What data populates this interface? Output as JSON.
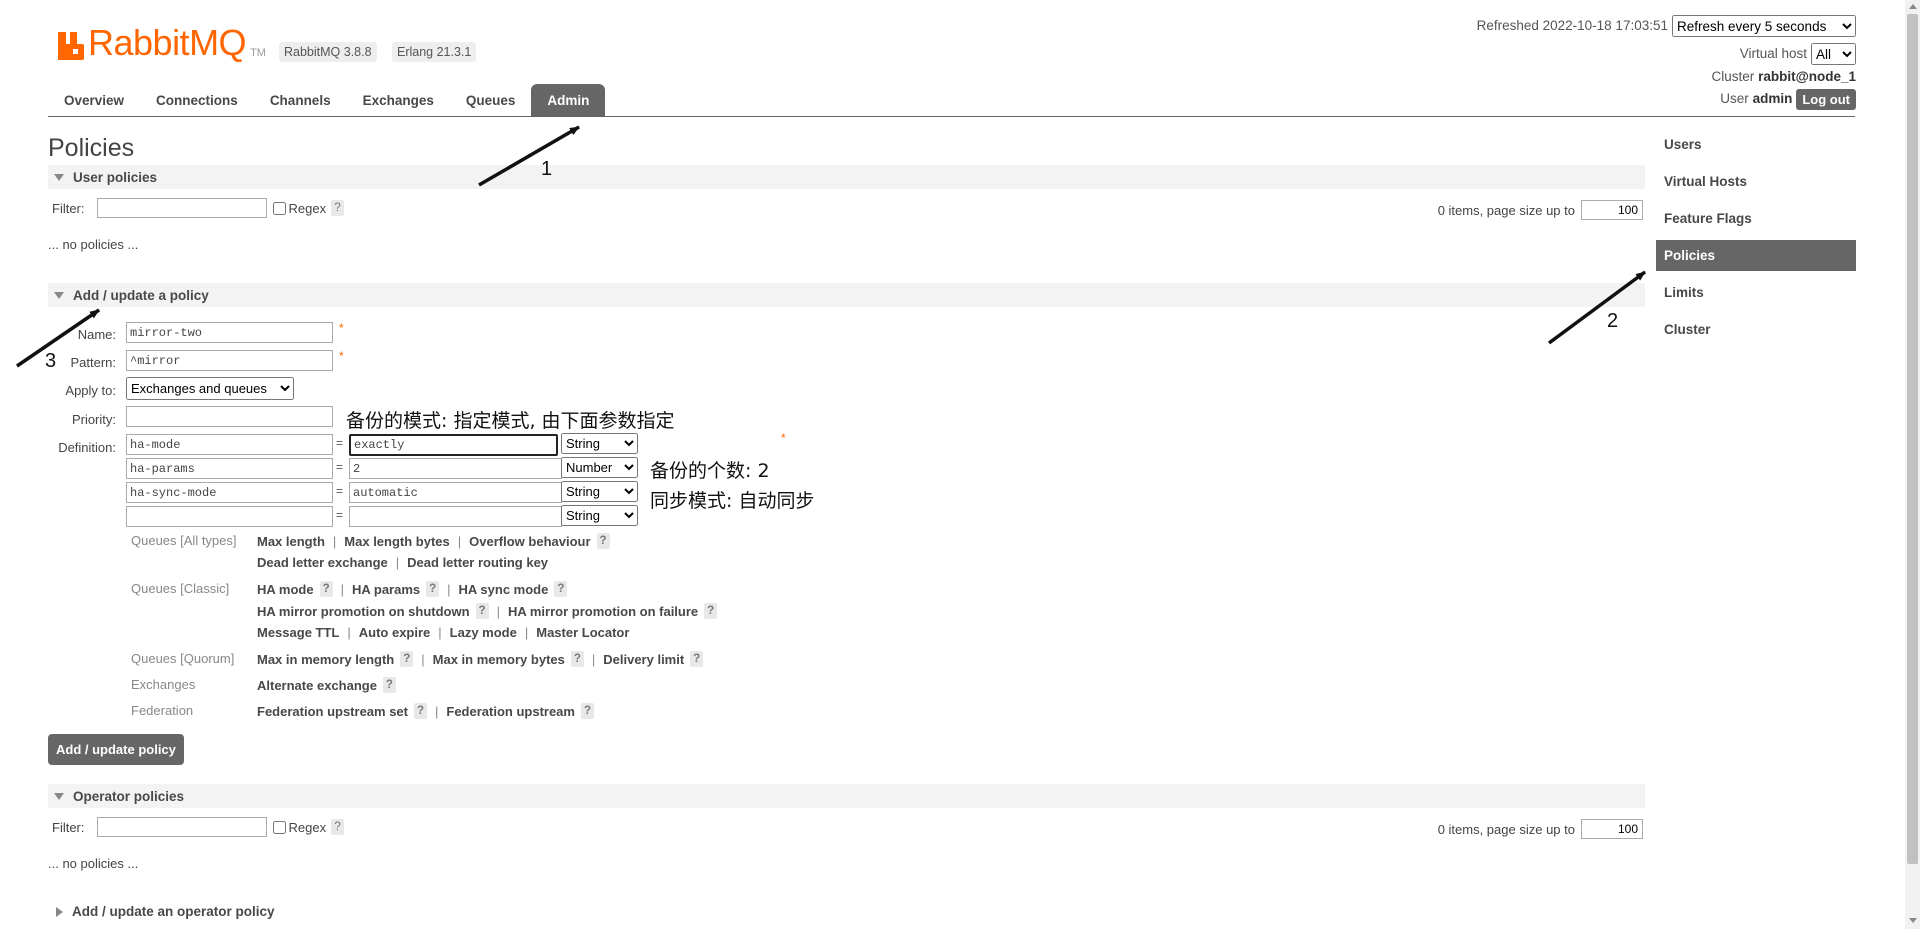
{
  "header": {
    "logo_text": "RabbitMQ",
    "logo_tm": "TM",
    "version": "RabbitMQ 3.8.8",
    "erlang": "Erlang 21.3.1",
    "refreshed_label": "Refreshed 2022-10-18 17:03:51",
    "refresh_option": "Refresh every 5 seconds",
    "virtual_host_label": "Virtual host",
    "virtual_host_value": "All",
    "cluster_label": "Cluster",
    "cluster_value": "rabbit@node_1",
    "user_label": "User",
    "user_value": "admin",
    "logout_label": "Log out",
    "brand_color": "#ff6600"
  },
  "nav": {
    "tabs": [
      "Overview",
      "Connections",
      "Channels",
      "Exchanges",
      "Queues",
      "Admin"
    ],
    "active": "Admin"
  },
  "page": {
    "title": "Policies"
  },
  "user_policies": {
    "header": "User policies",
    "filter_label": "Filter:",
    "regex_label": "Regex",
    "help": "?",
    "pager_text": "0 items, page size up to",
    "page_size": "100",
    "empty_text": "... no policies ..."
  },
  "add_policy": {
    "header": "Add / update a policy",
    "name_label": "Name:",
    "name_value": "mirror-two",
    "pattern_label": "Pattern:",
    "pattern_value": "^mirror",
    "apply_to_label": "Apply to:",
    "apply_to_value": "Exchanges and queues",
    "priority_label": "Priority:",
    "priority_value": "",
    "definition_label": "Definition:",
    "required_mark": "*",
    "equals": "=",
    "definitions": [
      {
        "key": "ha-mode",
        "value": "exactly",
        "type": "String"
      },
      {
        "key": "ha-params",
        "value": "2",
        "type": "Number"
      },
      {
        "key": "ha-sync-mode",
        "value": "automatic",
        "type": "String"
      },
      {
        "key": "",
        "value": "",
        "type": "String"
      }
    ],
    "categories": {
      "all_types": {
        "label": "Queues [All types]",
        "line1": [
          "Max length",
          "Max length bytes",
          "Overflow behaviour"
        ],
        "line2": [
          "Dead letter exchange",
          "Dead letter routing key"
        ]
      },
      "classic": {
        "label": "Queues [Classic]",
        "line1": [
          "HA mode",
          "HA params",
          "HA sync mode"
        ],
        "line2": [
          "HA mirror promotion on shutdown",
          "HA mirror promotion on failure"
        ],
        "line3": [
          "Message TTL",
          "Auto expire",
          "Lazy mode",
          "Master Locator"
        ]
      },
      "quorum": {
        "label": "Queues [Quorum]",
        "line1": [
          "Max in memory length",
          "Max in memory bytes",
          "Delivery limit"
        ]
      },
      "exchanges": {
        "label": "Exchanges",
        "line1": [
          "Alternate exchange"
        ]
      },
      "federation": {
        "label": "Federation",
        "line1": [
          "Federation upstream set",
          "Federation upstream"
        ]
      }
    },
    "submit_label": "Add / update policy"
  },
  "operator_policies": {
    "header": "Operator policies",
    "filter_label": "Filter:",
    "regex_label": "Regex",
    "help": "?",
    "pager_text": "0 items, page size up to",
    "page_size": "100",
    "empty_text": "... no policies ...",
    "add_header": "Add / update an operator policy"
  },
  "side_menu": {
    "items": [
      "Users",
      "Virtual Hosts",
      "Feature Flags",
      "Policies",
      "Limits",
      "Cluster"
    ],
    "active": "Policies"
  },
  "annotations": {
    "mode_note": "备份的模式: 指定模式, 由下面参数指定",
    "count_note": "备份的个数: 2",
    "sync_note": "同步模式: 自动同步",
    "step1": "1",
    "step2": "2",
    "step3": "3"
  }
}
